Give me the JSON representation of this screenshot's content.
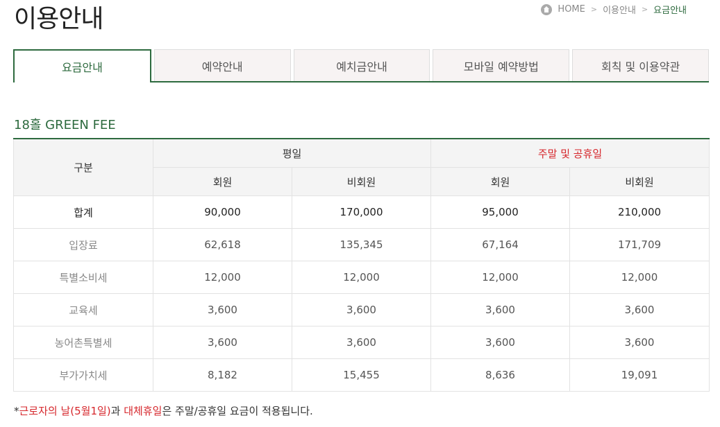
{
  "page": {
    "title": "이용안내"
  },
  "breadcrumb": {
    "home": "HOME",
    "items": [
      "이용안내",
      "요금안내"
    ],
    "separator": ">"
  },
  "tabs": [
    "요금안내",
    "예약안내",
    "예치금안내",
    "모바일 예약방법",
    "회칙 및 이용약관"
  ],
  "section": {
    "title": "18홀 GREEN FEE"
  },
  "table": {
    "header": {
      "category": "구분",
      "weekday": "평일",
      "weekend": "주말 및 공휴일",
      "member": "회원",
      "non_member": "비회원"
    },
    "rows": [
      {
        "label": "합계",
        "values": [
          "90,000",
          "170,000",
          "95,000",
          "210,000"
        ]
      },
      {
        "label": "입장료",
        "values": [
          "62,618",
          "135,345",
          "67,164",
          "171,709"
        ]
      },
      {
        "label": "특별소비세",
        "values": [
          "12,000",
          "12,000",
          "12,000",
          "12,000"
        ]
      },
      {
        "label": "교육세",
        "values": [
          "3,600",
          "3,600",
          "3,600",
          "3,600"
        ]
      },
      {
        "label": "농어촌특별세",
        "values": [
          "3,600",
          "3,600",
          "3,600",
          "3,600"
        ]
      },
      {
        "label": "부가가치세",
        "values": [
          "8,182",
          "15,455",
          "8,636",
          "19,091"
        ]
      }
    ]
  },
  "note": {
    "asterisk": "*",
    "labor_day": "근로자의 날(5월1일)",
    "and": "과 ",
    "substitute_holiday": "대체휴일",
    "rest": "은 주말/공휴일 요금이 적용됩니다."
  },
  "colors": {
    "accent": "#2d6a3e",
    "highlight": "#d6262b"
  }
}
